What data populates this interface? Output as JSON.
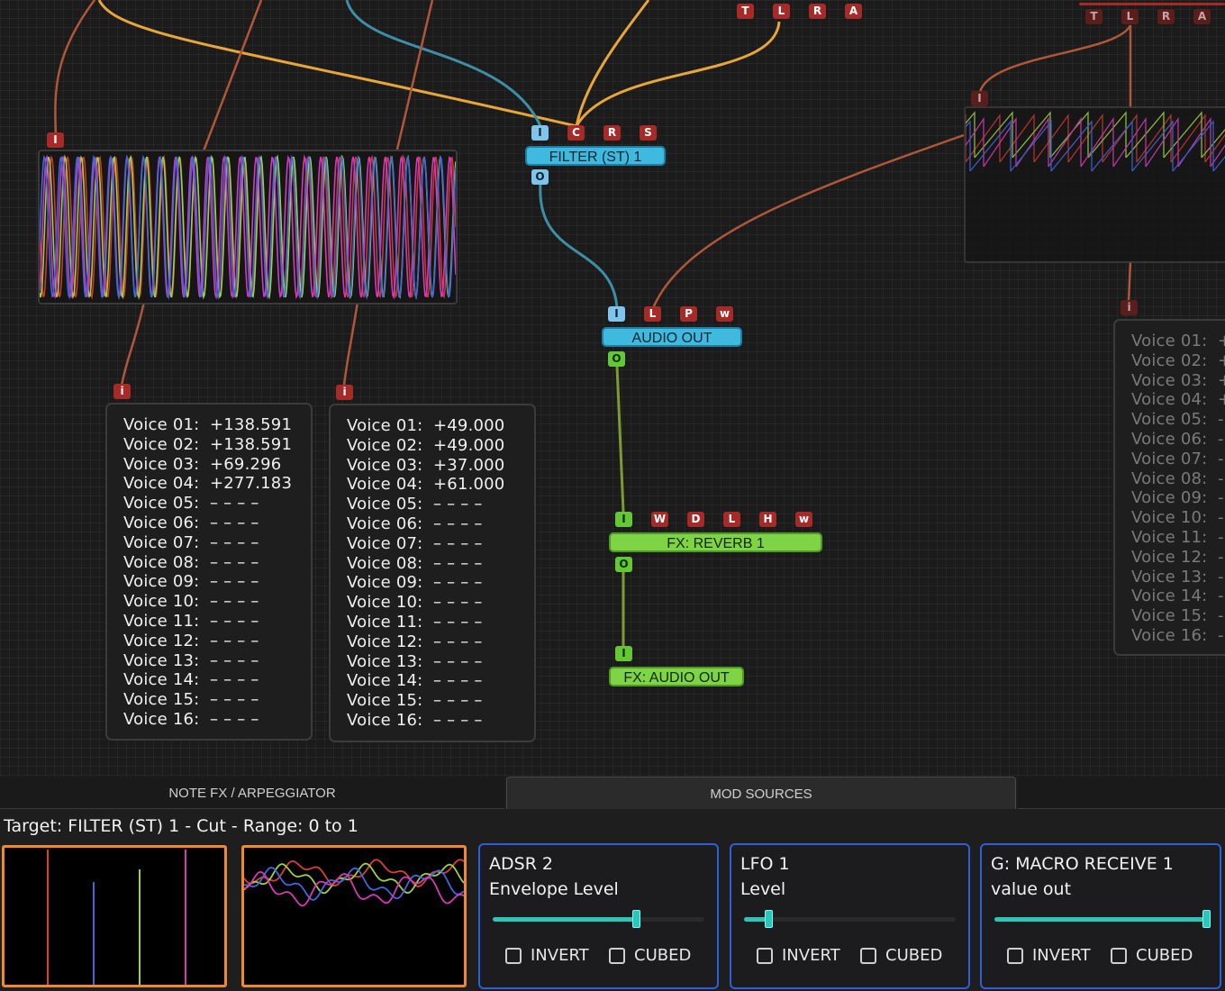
{
  "nodes": {
    "filter": "FILTER (ST) 1",
    "audio_out": "AUDIO OUT",
    "reverb": "FX: REVERB 1",
    "fx_audio_out": "FX: AUDIO OUT"
  },
  "ports": {
    "filter_in": [
      "I",
      "C",
      "R",
      "S"
    ],
    "filter_out": "O",
    "audio_out_in": [
      "I",
      "L",
      "P",
      "w"
    ],
    "audio_out_out": "O",
    "reverb_in": [
      "I",
      "W",
      "D",
      "L",
      "H",
      "w"
    ],
    "reverb_out": "O",
    "fx_audio_out_in": "I",
    "top_mid": [
      "T",
      "L",
      "R",
      "A"
    ],
    "top_right": [
      "T",
      "L",
      "R",
      "A"
    ],
    "scope_left_in": "I",
    "scope_right_in": "I",
    "voice1_in": "i",
    "voice2_in": "i",
    "voice3_in": "i"
  },
  "voice_table_1": [
    {
      "label": "Voice 01:",
      "value": "+138.591"
    },
    {
      "label": "Voice 02:",
      "value": "+138.591"
    },
    {
      "label": "Voice 03:",
      "value": "+69.296"
    },
    {
      "label": "Voice 04:",
      "value": "+277.183"
    },
    {
      "label": "Voice 05:",
      "value": "– – – –"
    },
    {
      "label": "Voice 06:",
      "value": "– – – –"
    },
    {
      "label": "Voice 07:",
      "value": "– – – –"
    },
    {
      "label": "Voice 08:",
      "value": "– – – –"
    },
    {
      "label": "Voice 09:",
      "value": "– – – –"
    },
    {
      "label": "Voice 10:",
      "value": "– – – –"
    },
    {
      "label": "Voice 11:",
      "value": "– – – –"
    },
    {
      "label": "Voice 12:",
      "value": "– – – –"
    },
    {
      "label": "Voice 13:",
      "value": "– – – –"
    },
    {
      "label": "Voice 14:",
      "value": "– – – –"
    },
    {
      "label": "Voice 15:",
      "value": "– – – –"
    },
    {
      "label": "Voice 16:",
      "value": "– – – –"
    }
  ],
  "voice_table_2": [
    {
      "label": "Voice 01:",
      "value": "+49.000"
    },
    {
      "label": "Voice 02:",
      "value": "+49.000"
    },
    {
      "label": "Voice 03:",
      "value": "+37.000"
    },
    {
      "label": "Voice 04:",
      "value": "+61.000"
    },
    {
      "label": "Voice 05:",
      "value": "– – – –"
    },
    {
      "label": "Voice 06:",
      "value": "– – – –"
    },
    {
      "label": "Voice 07:",
      "value": "– – – –"
    },
    {
      "label": "Voice 08:",
      "value": "– – – –"
    },
    {
      "label": "Voice 09:",
      "value": "– – – –"
    },
    {
      "label": "Voice 10:",
      "value": "– – – –"
    },
    {
      "label": "Voice 11:",
      "value": "– – – –"
    },
    {
      "label": "Voice 12:",
      "value": "– – – –"
    },
    {
      "label": "Voice 13:",
      "value": "– – – –"
    },
    {
      "label": "Voice 14:",
      "value": "– – – –"
    },
    {
      "label": "Voice 15:",
      "value": "– – – –"
    },
    {
      "label": "Voice 16:",
      "value": "– – – –"
    }
  ],
  "voice_table_3": [
    {
      "label": "Voice 01:",
      "value": "+"
    },
    {
      "label": "Voice 02:",
      "value": "+"
    },
    {
      "label": "Voice 03:",
      "value": "+"
    },
    {
      "label": "Voice 04:",
      "value": "+"
    },
    {
      "label": "Voice 05:",
      "value": "-"
    },
    {
      "label": "Voice 06:",
      "value": "-"
    },
    {
      "label": "Voice 07:",
      "value": "-"
    },
    {
      "label": "Voice 08:",
      "value": "-"
    },
    {
      "label": "Voice 09:",
      "value": "-"
    },
    {
      "label": "Voice 10:",
      "value": "-"
    },
    {
      "label": "Voice 11:",
      "value": "-"
    },
    {
      "label": "Voice 12:",
      "value": "-"
    },
    {
      "label": "Voice 13:",
      "value": "-"
    },
    {
      "label": "Voice 14:",
      "value": "-"
    },
    {
      "label": "Voice 15:",
      "value": "-"
    },
    {
      "label": "Voice 16:",
      "value": "-"
    }
  ],
  "tabs": {
    "note_fx": "NOTE FX / ARPEGGIATOR",
    "mod_sources": "MOD SOURCES",
    "active": "mod_sources"
  },
  "target_text": "Target: FILTER (ST) 1 - Cut - Range: 0 to 1",
  "mod_cards": [
    {
      "title": "ADSR 2",
      "subtitle": "Envelope Level",
      "level": 0.68,
      "invert": "INVERT",
      "cubed": "CUBED"
    },
    {
      "title": "LFO 1",
      "subtitle": "Level",
      "level": 0.12,
      "invert": "INVERT",
      "cubed": "CUBED"
    },
    {
      "title": "G: MACRO RECEIVE 1",
      "subtitle": "value out",
      "level": 1.0,
      "invert": "INVERT",
      "cubed": "CUBED"
    }
  ],
  "colors": {
    "port_red": "#a62a28",
    "node_blue": "#3fb9dd",
    "node_green": "#7ed445",
    "wire_orange": "#e8a53a",
    "wire_rust": "#b0573a",
    "wire_teal": "#3e8fa6",
    "wire_olive": "#7d9a33",
    "scope_border": "#f1882e",
    "card_border": "#2f5fd8",
    "slider": "#2ec4b6"
  }
}
